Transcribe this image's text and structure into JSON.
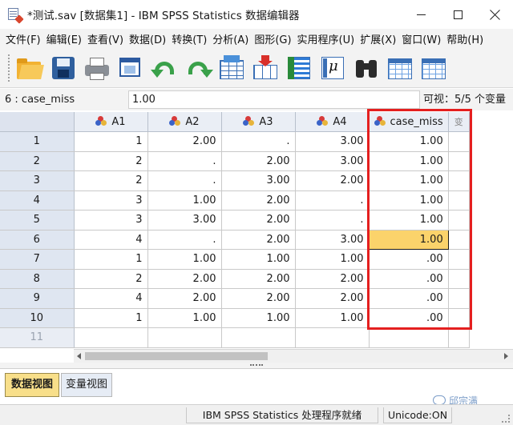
{
  "window": {
    "title": "*测试.sav [数据集1] - IBM SPSS Statistics 数据编辑器"
  },
  "menu": [
    {
      "label": "文件(F)"
    },
    {
      "label": "编辑(E)"
    },
    {
      "label": "查看(V)"
    },
    {
      "label": "数据(D)"
    },
    {
      "label": "转换(T)"
    },
    {
      "label": "分析(A)"
    },
    {
      "label": "图形(G)"
    },
    {
      "label": "实用程序(U)"
    },
    {
      "label": "扩展(X)"
    },
    {
      "label": "窗口(W)"
    },
    {
      "label": "帮助(H)"
    }
  ],
  "toolbar": {
    "icons": [
      "open-folder-icon",
      "save-icon",
      "print-icon",
      "recall-dialog-icon",
      "undo-icon",
      "redo-icon",
      "goto-case-icon",
      "goto-variable-icon",
      "variables-icon",
      "run-descriptive-statistics-icon",
      "find-icon",
      "insert-cases-icon",
      "insert-variable-icon"
    ]
  },
  "cell_ref": {
    "name": "6 : case_miss",
    "value": "1.00",
    "visible": "可视：5/5 个变量"
  },
  "grid": {
    "columns": [
      {
        "name": "A1",
        "icon": "nominal-variable-icon"
      },
      {
        "name": "A2",
        "icon": "nominal-variable-icon"
      },
      {
        "name": "A3",
        "icon": "nominal-variable-icon"
      },
      {
        "name": "A4",
        "icon": "nominal-variable-icon"
      },
      {
        "name": "case_miss",
        "icon": "nominal-variable-icon"
      },
      {
        "name": "变"
      }
    ],
    "rows": [
      {
        "num": "1",
        "cells": [
          "1",
          "2.00",
          ".",
          "3.00",
          "1.00"
        ]
      },
      {
        "num": "2",
        "cells": [
          "2",
          ".",
          "2.00",
          "3.00",
          "1.00"
        ]
      },
      {
        "num": "3",
        "cells": [
          "2",
          ".",
          "3.00",
          "2.00",
          "1.00"
        ]
      },
      {
        "num": "4",
        "cells": [
          "3",
          "1.00",
          "2.00",
          ".",
          "1.00"
        ]
      },
      {
        "num": "5",
        "cells": [
          "3",
          "3.00",
          "2.00",
          ".",
          "1.00"
        ]
      },
      {
        "num": "6",
        "cells": [
          "4",
          ".",
          "2.00",
          "3.00",
          "1.00"
        ]
      },
      {
        "num": "7",
        "cells": [
          "1",
          "1.00",
          "1.00",
          "1.00",
          ".00"
        ]
      },
      {
        "num": "8",
        "cells": [
          "2",
          "2.00",
          "2.00",
          "2.00",
          ".00"
        ]
      },
      {
        "num": "9",
        "cells": [
          "4",
          "2.00",
          "2.00",
          "2.00",
          ".00"
        ]
      },
      {
        "num": "10",
        "cells": [
          "1",
          "1.00",
          "1.00",
          "1.00",
          ".00"
        ]
      },
      {
        "num": "11",
        "cells": [
          "",
          "",
          "",
          "",
          ""
        ]
      }
    ],
    "selected_cell": {
      "row": "6",
      "column": "case_miss"
    },
    "highlight_color": "#e41f1f",
    "selected_color": "#fbd36b"
  },
  "tabs": [
    {
      "label": "数据视图",
      "active": true
    },
    {
      "label": "变量视图",
      "active": false
    }
  ],
  "watermark": "邱宗满",
  "status": {
    "main": "IBM SPSS Statistics 处理程序就绪",
    "encoding": "Unicode:ON"
  }
}
